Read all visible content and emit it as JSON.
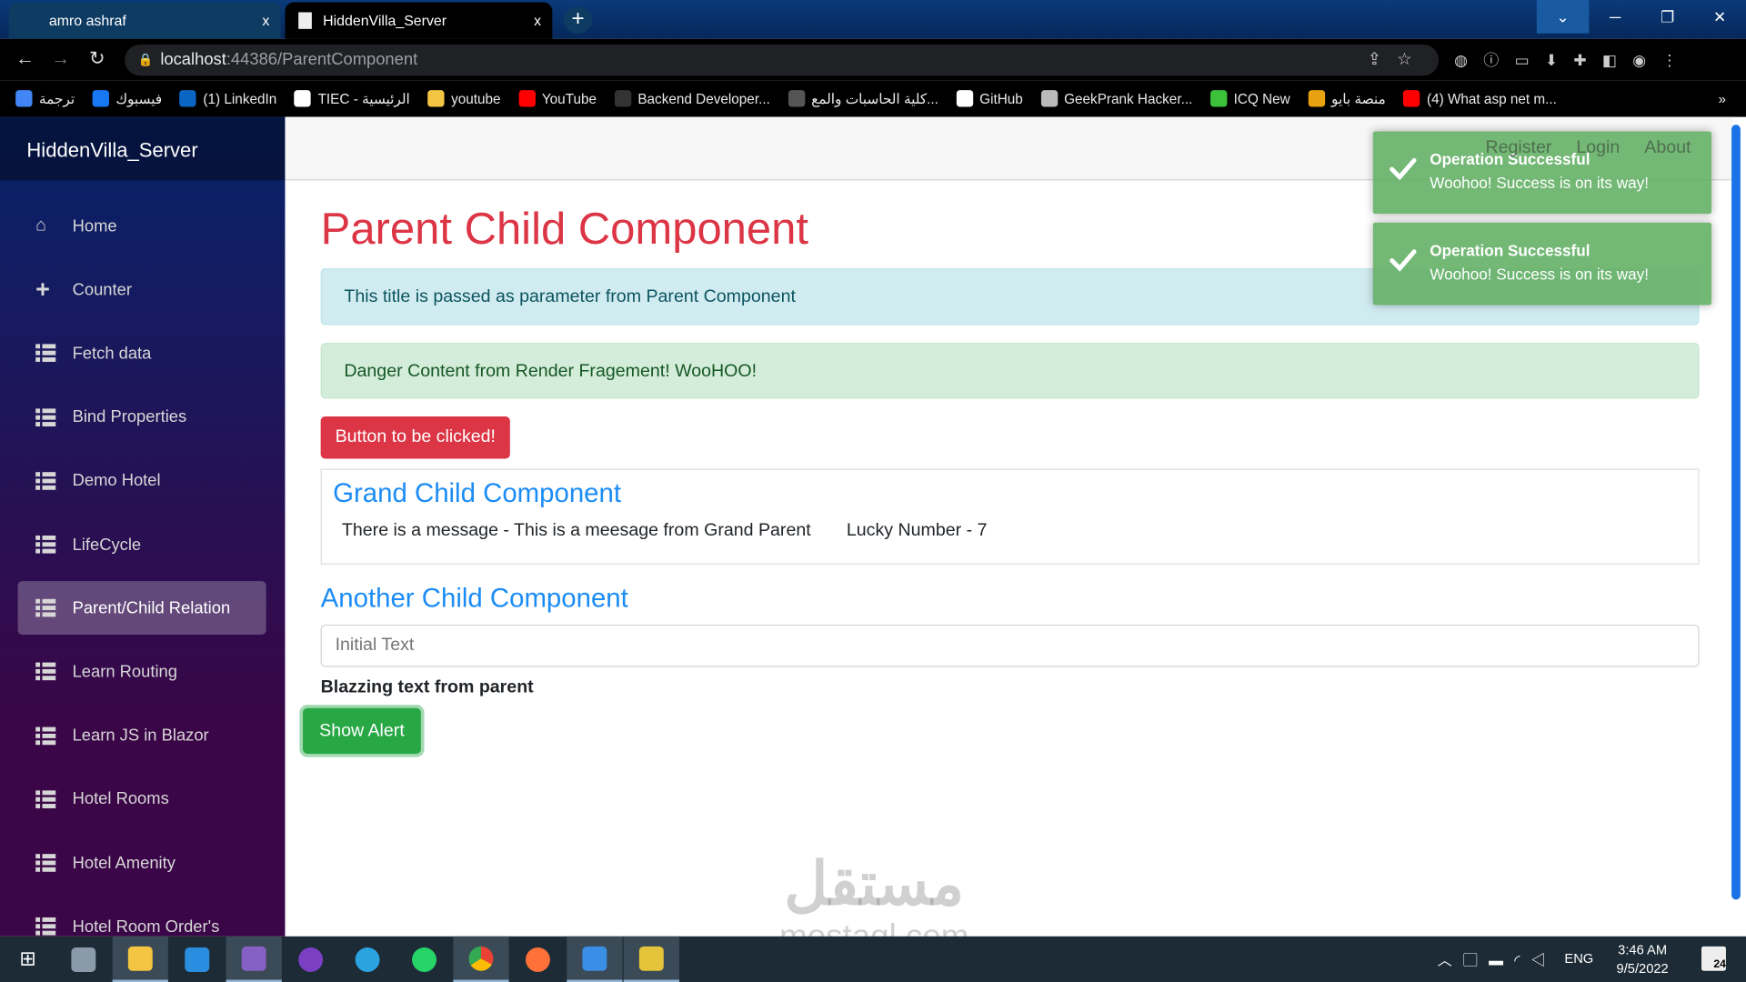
{
  "browser": {
    "tabs": [
      {
        "label": "amro ashraf",
        "close": "x"
      },
      {
        "label": "HiddenVilla_Server",
        "close": "x",
        "active": true
      }
    ],
    "new_tab": "+",
    "url_host": "localhost",
    "url_rest": ":44386/ParentComponent",
    "bookmarks": [
      {
        "label": "ترجمة",
        "color": "#4285f4"
      },
      {
        "label": "فيسبوك",
        "color": "#1877f2"
      },
      {
        "label": "(1) LinkedIn",
        "color": "#0a66c2"
      },
      {
        "label": "TIEC - الرئيسية",
        "color": "#ffffff"
      },
      {
        "label": "youtube",
        "color": "#f4c542"
      },
      {
        "label": "YouTube",
        "color": "#ff0000"
      },
      {
        "label": "Backend Developer...",
        "color": "#333333"
      },
      {
        "label": "كلية الحاسبات والمع...",
        "color": "#555555"
      },
      {
        "label": "GitHub",
        "color": "#ffffff"
      },
      {
        "label": "GeekPrank Hacker...",
        "color": "#bbbbbb"
      },
      {
        "label": "ICQ New",
        "color": "#3cc13b"
      },
      {
        "label": "منصة بايو",
        "color": "#e8a10f"
      },
      {
        "label": "(4) What asp net m...",
        "color": "#ff0000"
      }
    ],
    "more": "»"
  },
  "sidebar": {
    "brand": "HiddenVilla_Server",
    "items": [
      {
        "label": "Home",
        "icon": "home-icon"
      },
      {
        "label": "Counter",
        "icon": "plus-icon"
      },
      {
        "label": "Fetch data",
        "icon": "list-icon"
      },
      {
        "label": "Bind Properties",
        "icon": "list-icon"
      },
      {
        "label": "Demo Hotel",
        "icon": "list-icon"
      },
      {
        "label": "LifeCycle",
        "icon": "list-icon"
      },
      {
        "label": "Parent/Child Relation",
        "icon": "list-icon",
        "active": true
      },
      {
        "label": "Learn Routing",
        "icon": "list-icon"
      },
      {
        "label": "Learn JS in Blazor",
        "icon": "list-icon"
      },
      {
        "label": "Hotel Rooms",
        "icon": "list-icon"
      },
      {
        "label": "Hotel Amenity",
        "icon": "list-icon"
      },
      {
        "label": "Hotel Room Order's",
        "icon": "list-icon"
      }
    ]
  },
  "topbar": {
    "links": [
      "Register",
      "Login",
      "About"
    ]
  },
  "main": {
    "title": "Parent Child Component",
    "info_alert": "This title is passed as parameter from Parent Component",
    "success_alert": "Danger Content from Render Fragement! WooHOO!",
    "danger_button": "Button to be clicked!",
    "grand_child": {
      "title": "Grand Child Component",
      "message": "There is a message - This is a meesage from Grand Parent",
      "lucky": "Lucky Number - 7"
    },
    "another_child": {
      "title": "Another Child Component",
      "input_placeholder": "Initial Text",
      "bold_text": "Blazzing text from parent"
    },
    "show_alert": "Show Alert"
  },
  "toasts": [
    {
      "title": "Operation Successful",
      "message": "Woohoo! Success is on its way!"
    },
    {
      "title": "Operation Successful",
      "message": "Woohoo! Success is on its way!"
    }
  ],
  "watermark": {
    "arabic": "مستقل",
    "latin": "mostaql.com"
  },
  "taskbar": {
    "time": "3:46 AM",
    "date": "9/5/2022",
    "lang": "ENG",
    "notifications": "24"
  },
  "colors": {
    "accent": "#1b8cf5",
    "danger": "#dc3545",
    "success": "#28a745",
    "toast": "#74b876"
  }
}
